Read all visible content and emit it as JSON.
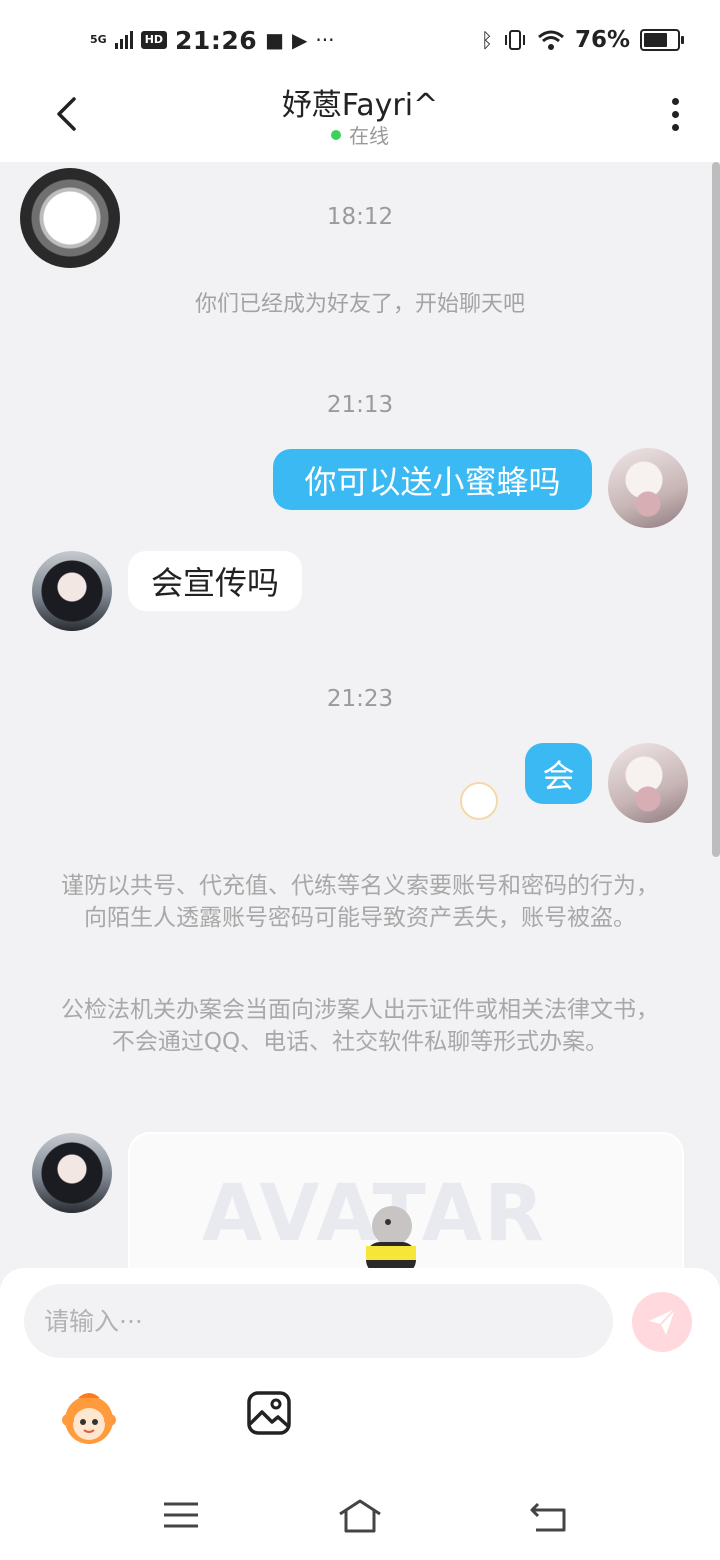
{
  "status_bar": {
    "network": "5G",
    "hd": "HD",
    "time": "21:26",
    "more": "···",
    "battery_percent": "76%",
    "battery_level": 0.76
  },
  "header": {
    "title": "妤蒽Fayri^",
    "status": "在线",
    "status_color": "#3dd35a"
  },
  "chat": {
    "messages": [
      {
        "type": "timestamp",
        "text": "18:12"
      },
      {
        "type": "system",
        "text": "你们已经成为好友了，开始聊天吧"
      },
      {
        "type": "timestamp",
        "text": "21:13"
      },
      {
        "type": "outgoing",
        "text": "你可以送小蜜蜂吗"
      },
      {
        "type": "incoming",
        "text": "会宣传吗"
      },
      {
        "type": "timestamp",
        "text": "21:23"
      },
      {
        "type": "outgoing",
        "text": "会"
      }
    ],
    "warning": [
      "谨防以共号、代充值、代练等名义索要账号和密码的行为，向陌生人透露账号密码可能导致资产丢失，账号被盗。",
      "公检法机关办案会当面向涉案人出示证件或相关法律文书，不会通过QQ、电话、社交软件私聊等形式办案。"
    ],
    "card_text": "AVATAR",
    "bubble_color": "#3bb9f3"
  },
  "composer": {
    "placeholder": "请输入···",
    "send_icon": "send-icon",
    "tools": [
      "emoji-icon",
      "image-icon"
    ]
  },
  "nav_bar": {
    "icons": [
      "menu-icon",
      "home-icon",
      "back-icon"
    ]
  }
}
